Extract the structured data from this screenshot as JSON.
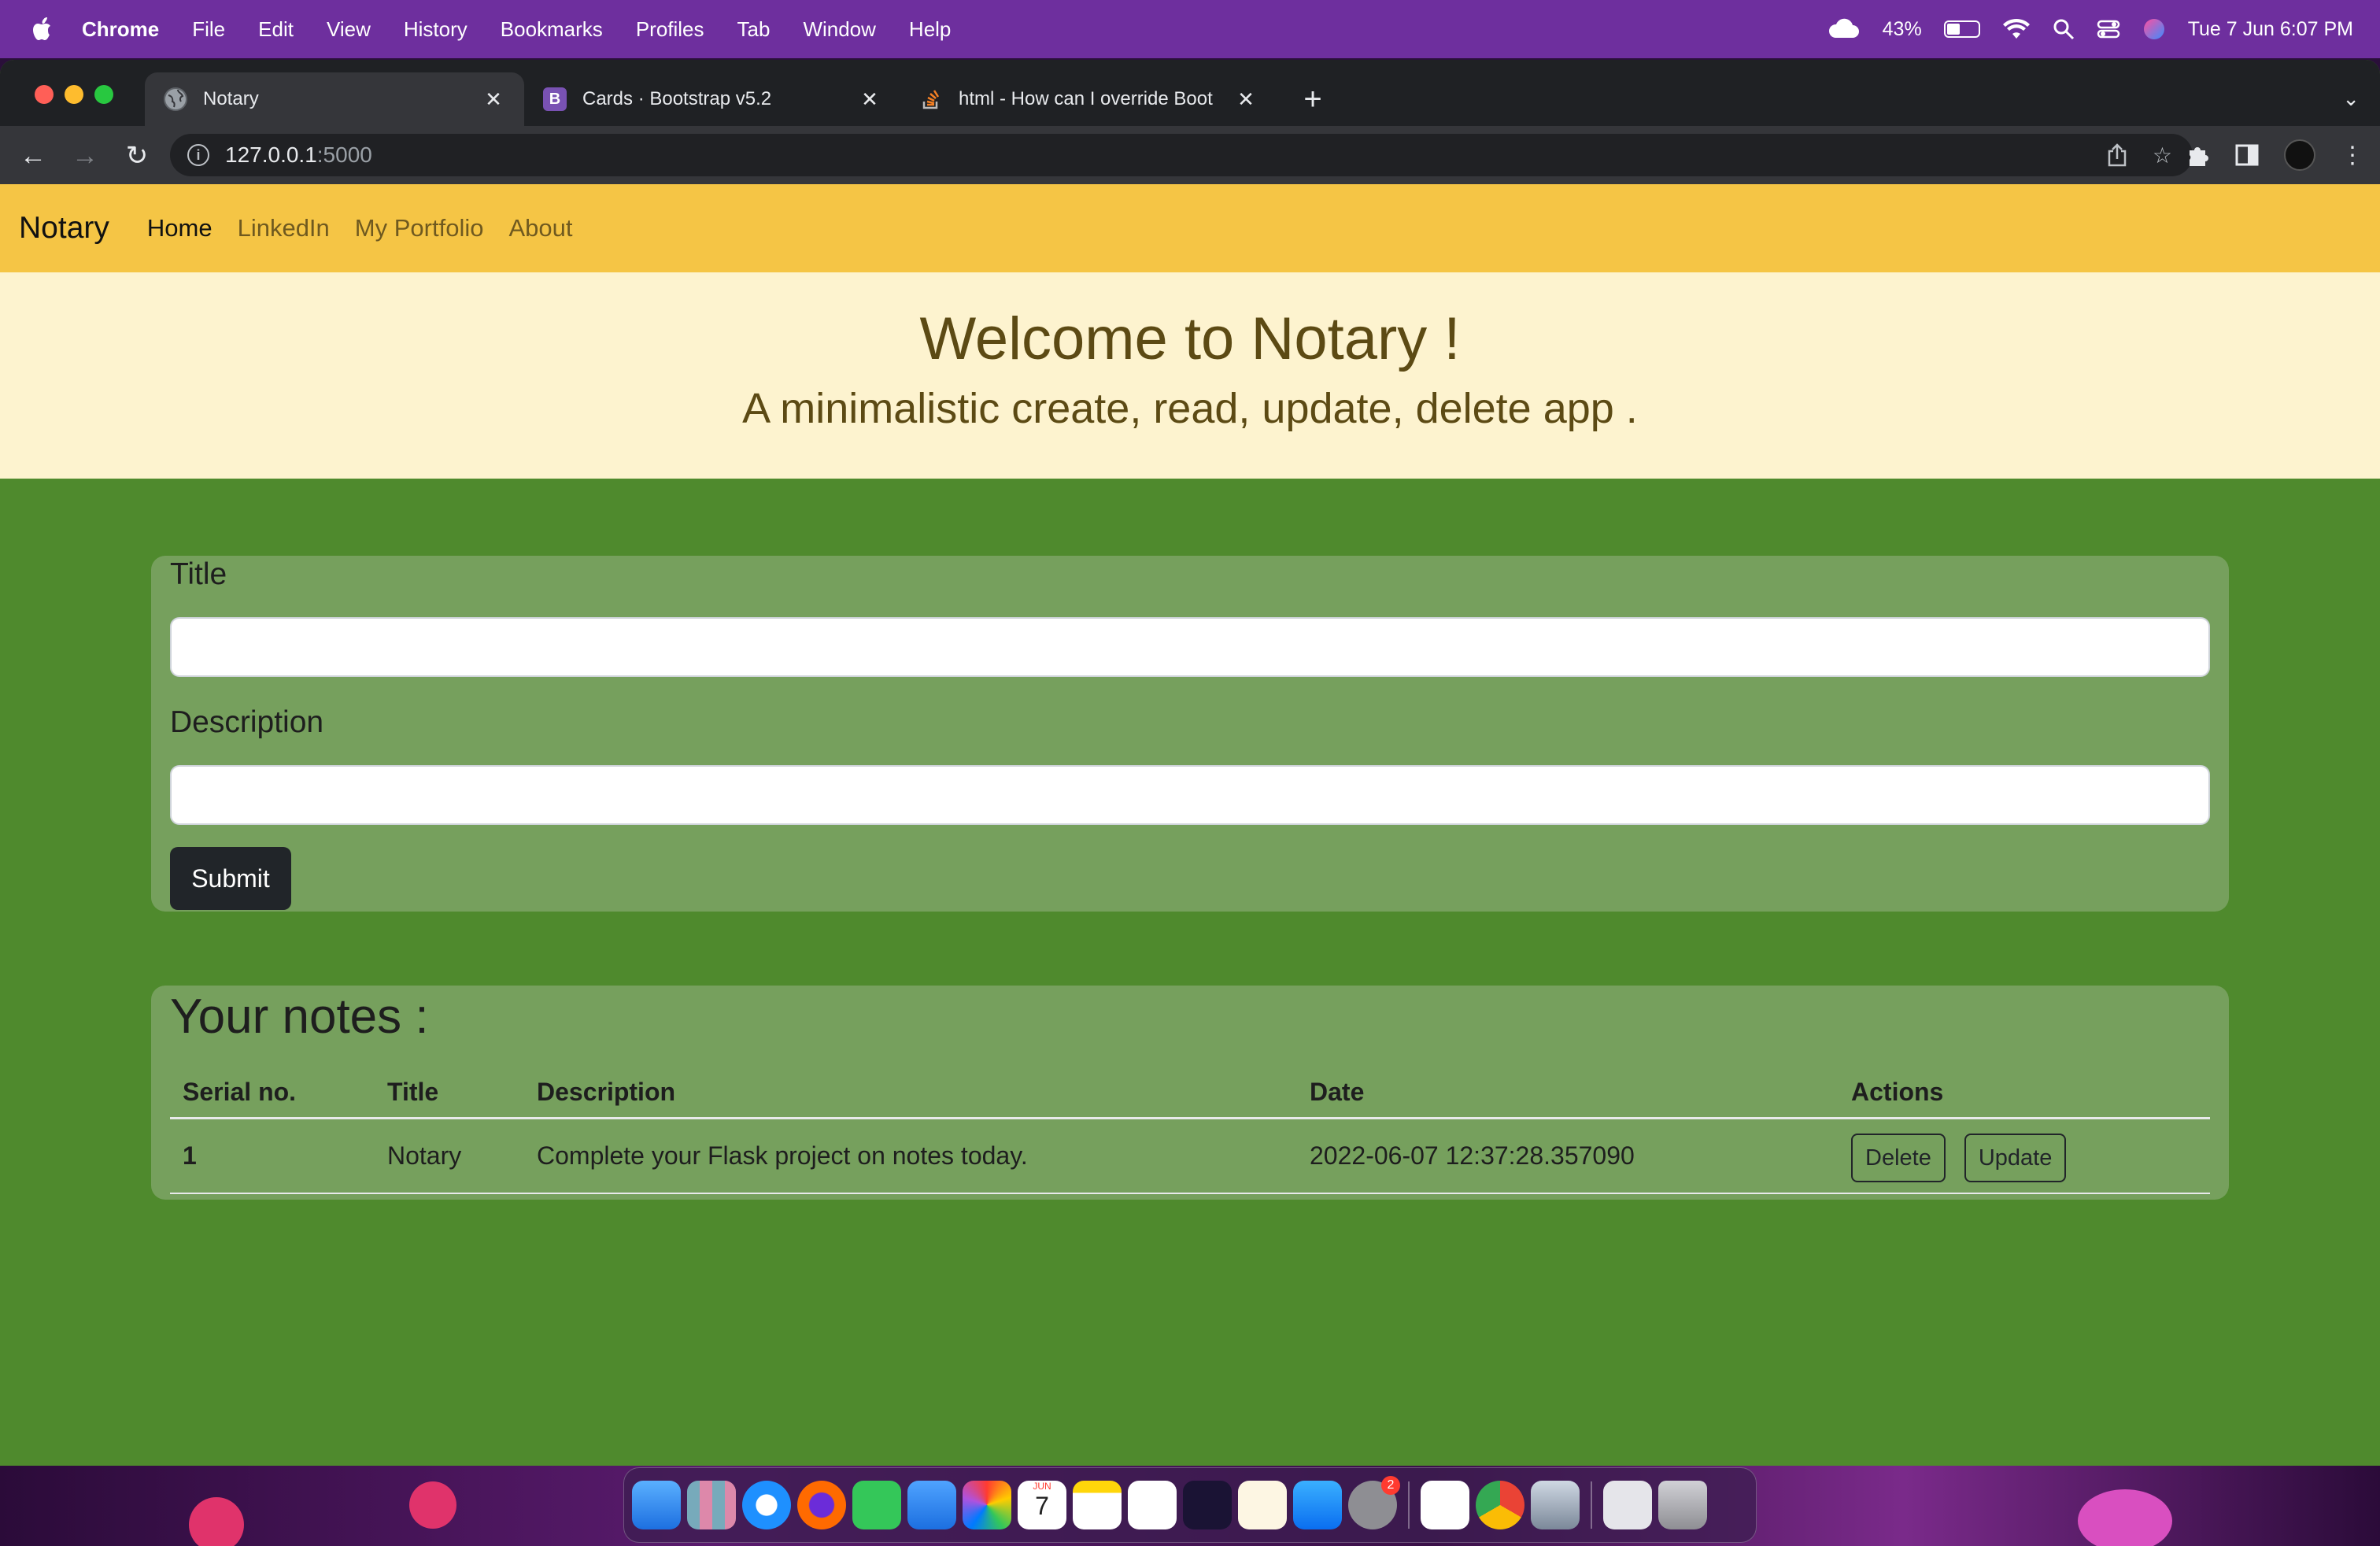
{
  "menubar": {
    "app_name": "Chrome",
    "items": [
      "File",
      "Edit",
      "View",
      "History",
      "Bookmarks",
      "Profiles",
      "Tab",
      "Window",
      "Help"
    ],
    "battery_percent": "43%",
    "datetime": "Tue 7 Jun  6:07 PM",
    "battery_level": 0.43
  },
  "browser": {
    "tabs": [
      {
        "title": "Notary",
        "favicon": "globe-icon",
        "active": true
      },
      {
        "title": "Cards · Bootstrap v5.2",
        "favicon": "bootstrap-icon",
        "favicon_letter": "B"
      },
      {
        "title": "html - How can I override Boot",
        "favicon": "stackoverflow-icon"
      }
    ],
    "url_host": "127.0.0.1",
    "url_port": ":5000"
  },
  "navbar": {
    "brand": "Notary",
    "links": [
      "Home",
      "LinkedIn",
      "My Portfolio",
      "About"
    ],
    "active": "Home"
  },
  "hero": {
    "title": "Welcome to Notary !",
    "subtitle": "A minimalistic create, read, update, delete app ."
  },
  "form": {
    "title_label": "Title",
    "title_value": "",
    "description_label": "Description",
    "description_value": "",
    "submit_label": "Submit"
  },
  "notes": {
    "heading": "Your notes :",
    "columns": [
      "Serial no.",
      "Title",
      "Description",
      "Date",
      "Actions"
    ],
    "rows": [
      {
        "serial": "1",
        "title": "Notary",
        "description": "Complete your Flask project on notes today.",
        "date": "2022-06-07 12:37:28.357090",
        "delete_label": "Delete",
        "update_label": "Update"
      }
    ]
  },
  "colors": {
    "navbar": "#f5c545",
    "hero_bg": "#fdf3cf",
    "page_bg": "#4f8a2d",
    "card_bg": "#76a05d",
    "menubar": "#6e2f9e"
  },
  "dock": {
    "apps": [
      "finder-icon",
      "launchpad-icon",
      "safari-icon",
      "firefox-icon",
      "messages-icon",
      "mail-icon",
      "photos-icon",
      "calendar-icon",
      "notes-icon",
      "numbers-icon",
      "affinity-icon",
      "textedit-icon",
      "app-store-icon",
      "system-preferences-icon",
      "vscode-icon",
      "chrome-icon",
      "preview-icon",
      "document-icon",
      "trash-icon"
    ],
    "calendar_month": "JUN",
    "calendar_day": "7",
    "badge_count": "2"
  }
}
